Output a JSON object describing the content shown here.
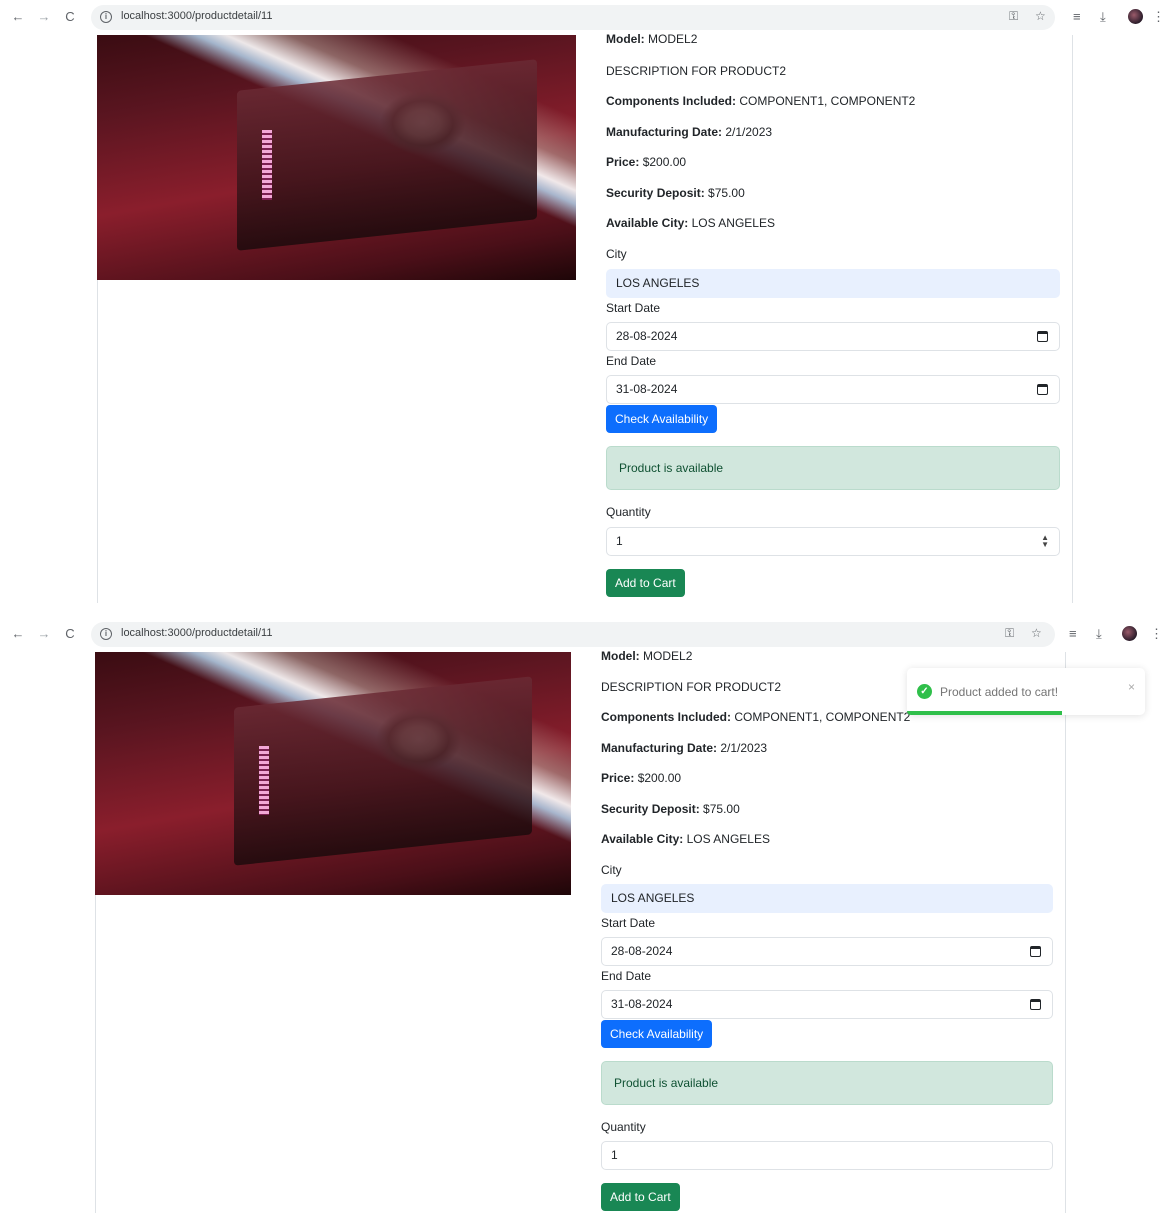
{
  "browser": {
    "url": "localhost:3000/productdetail/11",
    "back_icon": "←",
    "forward_icon": "→",
    "reload_icon": "C",
    "info_icon": "i",
    "key_icon": "⚿",
    "star_icon": "☆",
    "media_icon": "≡",
    "download_icon": "⤓",
    "menu_icon": "⋮"
  },
  "product": {
    "model_label": "Model:",
    "model_value": "MODEL2",
    "description": "DESCRIPTION FOR PRODUCT2",
    "components_label": "Components Included:",
    "components_value": "COMPONENT1, COMPONENT2",
    "mfg_label": "Manufacturing Date:",
    "mfg_value": "2/1/2023",
    "price_label": "Price:",
    "price_value": "$200.00",
    "deposit_label": "Security Deposit:",
    "deposit_value": "$75.00",
    "city_label": "Available City:",
    "city_value": "LOS ANGELES"
  },
  "form": {
    "city_label": "City",
    "city_value": "LOS ANGELES",
    "start_label": "Start Date",
    "start_value": "28-08-2024",
    "end_label": "End Date",
    "end_value": "31-08-2024",
    "check_button": "Check Availability",
    "availability_message": "Product is available",
    "quantity_label": "Quantity",
    "quantity_value": "1",
    "add_button": "Add to Cart"
  },
  "toast": {
    "message": "Product added to cart!",
    "close": "×",
    "check_icon": "✓",
    "progress": 0.65
  },
  "colors": {
    "primary": "#0d6efd",
    "success": "#198754",
    "alert_bg": "#d1e7dd",
    "toast_accent": "#2fbf4a"
  }
}
